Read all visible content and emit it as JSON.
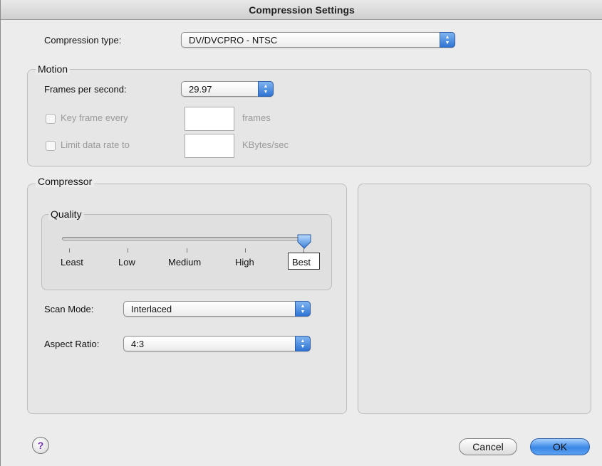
{
  "window": {
    "title": "Compression Settings"
  },
  "compression": {
    "label": "Compression type:",
    "value": "DV/DVCPRO - NTSC"
  },
  "motion": {
    "title": "Motion",
    "fps_label": "Frames per second:",
    "fps_value": "29.97",
    "keyframe_label": "Key frame every",
    "keyframe_unit": "frames",
    "keyframe_checked": false,
    "datarate_label": "Limit data rate to",
    "datarate_unit": "KBytes/sec",
    "datarate_checked": false
  },
  "compressor": {
    "title": "Compressor",
    "quality": {
      "title": "Quality",
      "levels": [
        "Least",
        "Low",
        "Medium",
        "High",
        "Best"
      ],
      "selected": "Best",
      "value_fraction": 1.0
    },
    "scan_mode_label": "Scan Mode:",
    "scan_mode_value": "Interlaced",
    "aspect_label": "Aspect Ratio:",
    "aspect_value": "4:3"
  },
  "footer": {
    "help_label": "?",
    "cancel_label": "Cancel",
    "ok_label": "OK"
  },
  "colors": {
    "accent": "#3a87e6",
    "help": "#6f2fb0"
  },
  "icons": {
    "popup_arrows": "up-down-arrows-icon",
    "help": "help-icon",
    "slider_thumb": "slider-thumb-icon"
  }
}
